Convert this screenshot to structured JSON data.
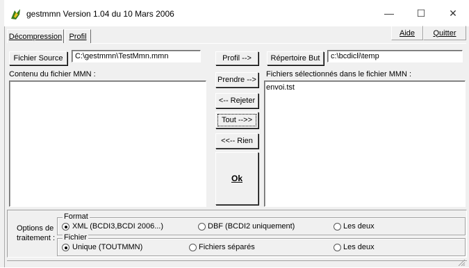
{
  "window": {
    "title": "gestmmn  Version 1.04 du 10 Mars 2006",
    "minimize_glyph": "—",
    "maximize_glyph": "☐",
    "close_glyph": "✕"
  },
  "tabs": [
    {
      "label": "Décompression",
      "active": true
    },
    {
      "label": "Profil",
      "active": false
    }
  ],
  "menu": {
    "aide_label": "Aide",
    "quitter_label": "Quitter"
  },
  "source": {
    "button_label": "Fichier Source",
    "path_value": "C:\\gestmmn\\TestMmn.mmn",
    "content_label": "Contenu du fichier MMN :",
    "items": []
  },
  "dest": {
    "button_label": "Répertoire But",
    "path_value": "c:\\bcdicli\\temp",
    "selected_label": "Fichiers sélectionnés dans le fichier MMN :",
    "items": [
      "envoi.tst"
    ]
  },
  "actions": {
    "profil": "Profil -->",
    "prendre": "Prendre -->",
    "rejeter": "<-- Rejeter",
    "tout": "Tout -->>",
    "rien": "<<-- Rien",
    "ok": "Ok"
  },
  "options": {
    "label_line1": "Options de",
    "label_line2": "traitement :",
    "format": {
      "title": "Format",
      "choices": [
        {
          "label": "XML (BCDI3,BCDI 2006...)",
          "selected": true
        },
        {
          "label": "DBF (BCDI2 uniquement)",
          "selected": false
        },
        {
          "label": "Les deux",
          "selected": false
        }
      ]
    },
    "fichier": {
      "title": "Fichier",
      "choices": [
        {
          "label": "Unique (TOUTMMN)",
          "selected": true
        },
        {
          "label": "Fichiers séparés",
          "selected": false
        },
        {
          "label": "Les deux",
          "selected": false
        }
      ]
    }
  },
  "colors": {
    "face": "#f0f0f0",
    "titlebar": "#ffffff",
    "app_icon_green": "#3a7d1e",
    "app_icon_yellow": "#e8c21a"
  }
}
